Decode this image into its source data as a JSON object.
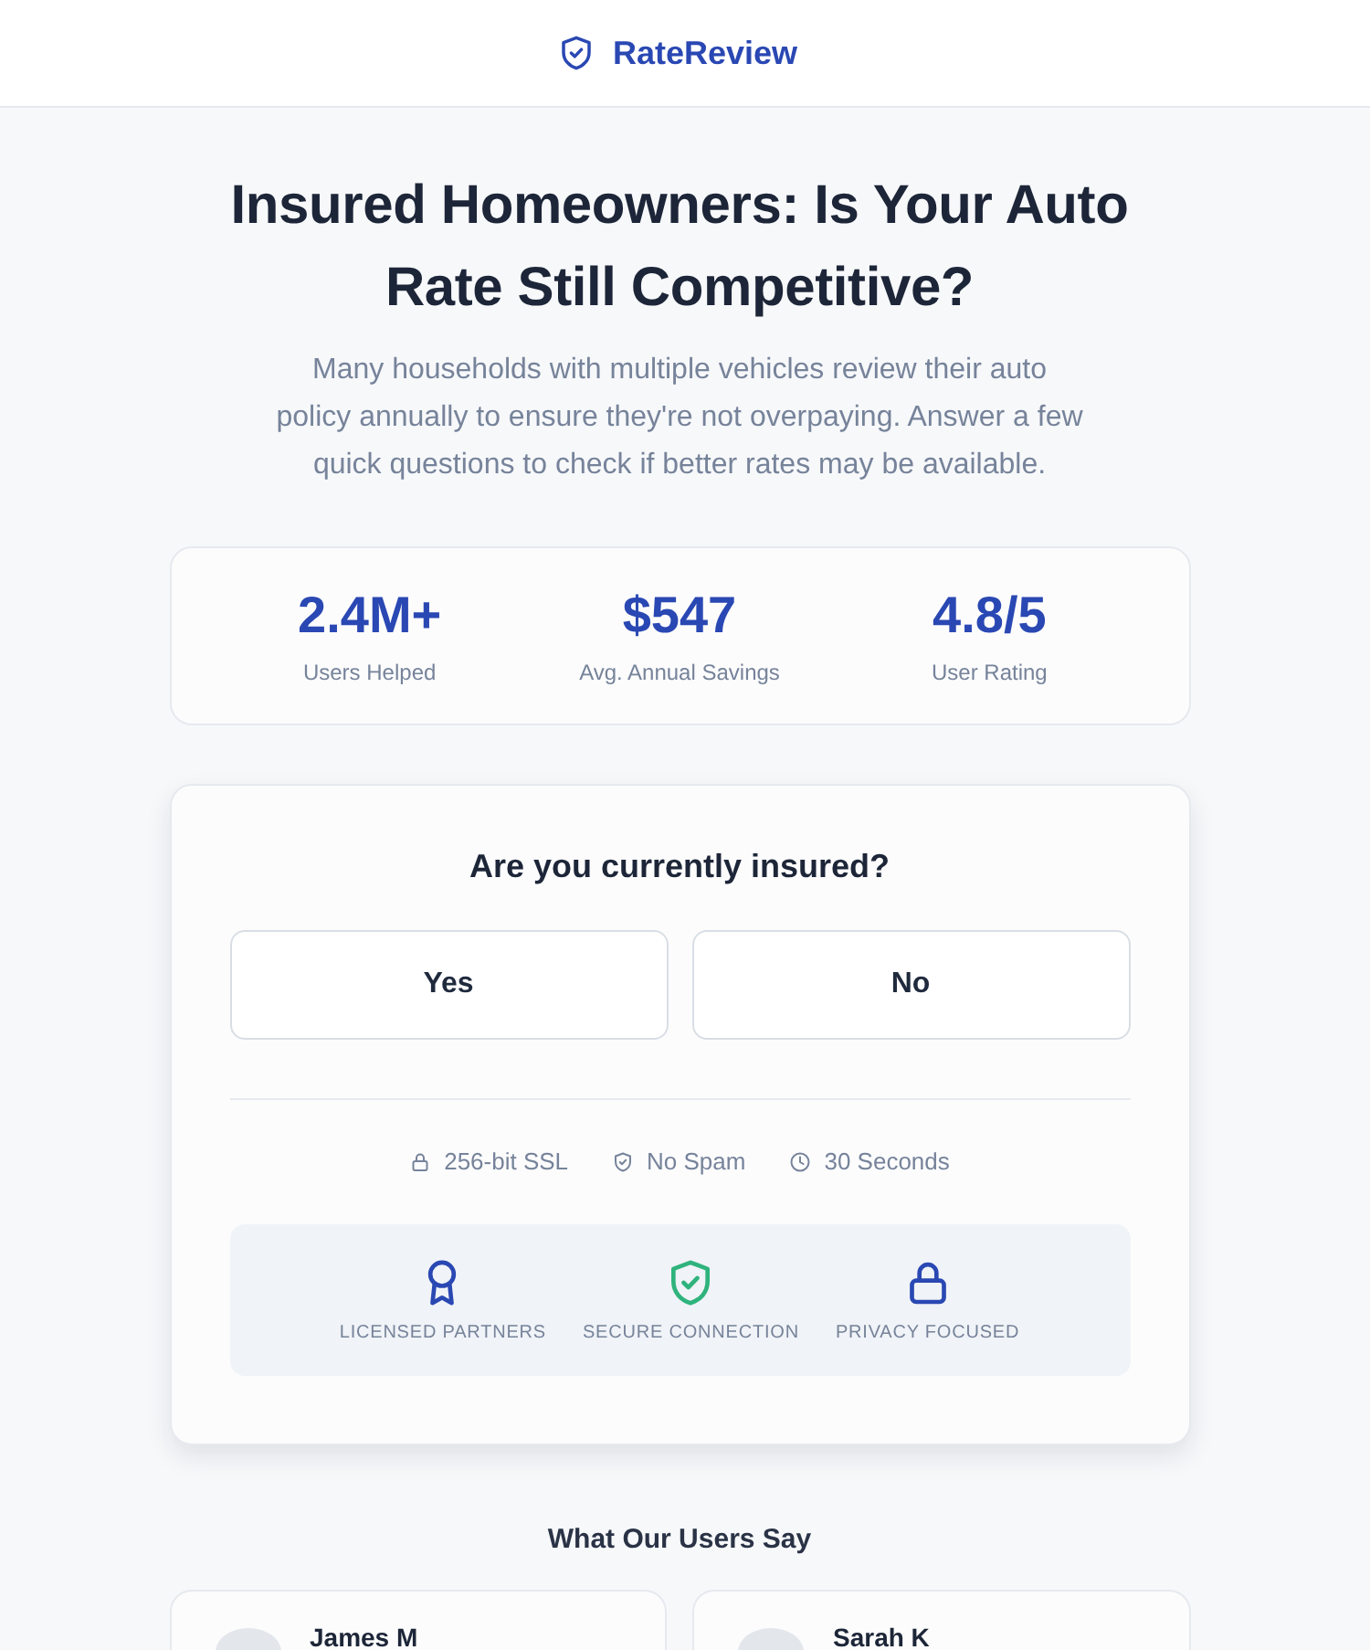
{
  "header": {
    "brand": "RateReview"
  },
  "hero": {
    "title": "Insured Homeowners: Is Your Auto Rate Still Competitive?",
    "subtitle": "Many households with multiple vehicles review their auto policy annually to ensure they're not overpaying. Answer a few quick questions to check if better rates may be available."
  },
  "stats": [
    {
      "value": "2.4M+",
      "label": "Users Helped"
    },
    {
      "value": "$547",
      "label": "Avg. Annual Savings"
    },
    {
      "value": "4.8/5",
      "label": "User Rating"
    }
  ],
  "question": {
    "prompt": "Are you currently insured?",
    "options": [
      {
        "label": "Yes",
        "selected": false
      },
      {
        "label": "No",
        "selected": false
      }
    ],
    "assurances": [
      {
        "kind": "lock",
        "label": "256-bit SSL"
      },
      {
        "kind": "shield",
        "label": "No Spam"
      },
      {
        "kind": "clock",
        "label": "30 Seconds"
      }
    ],
    "badges": [
      {
        "kind": "ribbon",
        "label": "LICENSED PARTNERS"
      },
      {
        "kind": "shield",
        "label": "SECURE CONNECTION"
      },
      {
        "kind": "lock",
        "label": "PRIVACY FOCUSED"
      }
    ]
  },
  "testimonials": {
    "heading": "What Our Users Say",
    "items": [
      {
        "name": "James M"
      },
      {
        "name": "Sarah K"
      }
    ]
  }
}
